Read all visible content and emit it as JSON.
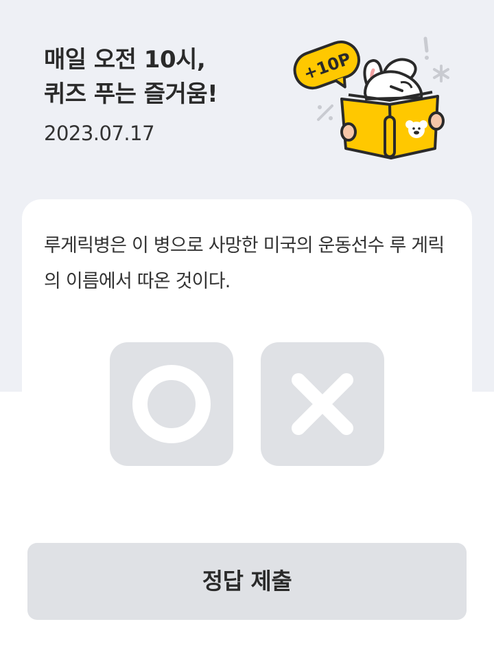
{
  "header": {
    "headline_line1": "매일 오전 10시,",
    "headline_line2": "퀴즈 푸는 즐거움!",
    "date": "2023.07.17"
  },
  "illustration": {
    "badge_text": "+10P",
    "icon": "rabbit-reading-book-icon"
  },
  "quiz": {
    "question": "루게릭병은 이 병으로 사망한 미국의 운동선수 루 게릭의 이름에서 따온 것이다.",
    "options": [
      {
        "icon": "circle-o-icon",
        "meaning": "O"
      },
      {
        "icon": "cross-x-icon",
        "meaning": "X"
      }
    ]
  },
  "submit": {
    "label": "정답 제출"
  },
  "colors": {
    "top_background": "#eef0f5",
    "card_background": "#ffffff",
    "button_gray": "#dfe1e5",
    "accent_yellow": "#ffc800",
    "text_dark": "#2a2a2a"
  }
}
